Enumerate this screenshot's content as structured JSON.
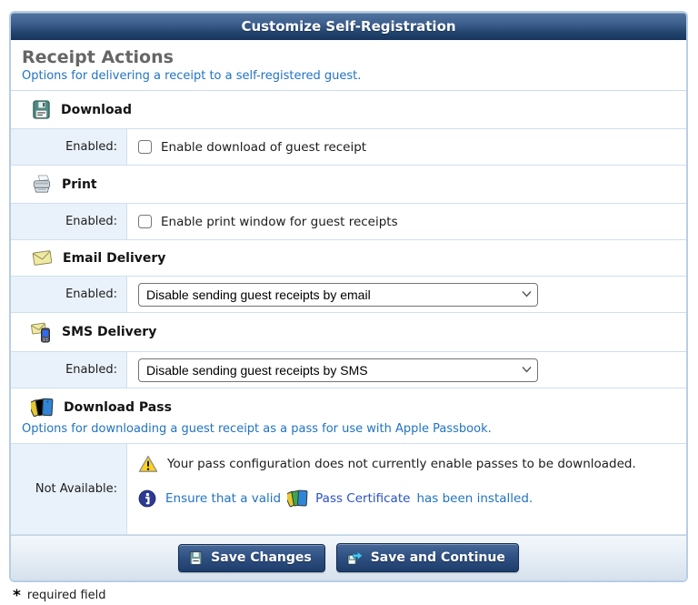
{
  "title": "Customize Self-Registration",
  "section": {
    "title": "Receipt Actions",
    "subtitle": "Options for delivering a receipt to a self-registered guest."
  },
  "items": {
    "download": {
      "title": "Download",
      "label": "Enabled:",
      "checkbox_label": "Enable download of guest receipt",
      "checked": false
    },
    "print": {
      "title": "Print",
      "label": "Enabled:",
      "checkbox_label": "Enable print window for guest receipts",
      "checked": false
    },
    "email": {
      "title": "Email Delivery",
      "label": "Enabled:",
      "selected_option": "Disable sending guest receipts by email"
    },
    "sms": {
      "title": "SMS Delivery",
      "label": "Enabled:",
      "selected_option": "Disable sending guest receipts by SMS"
    },
    "pass": {
      "title": "Download Pass",
      "subtitle": "Options for downloading a guest receipt as a pass for use with Apple Passbook.",
      "label": "Not Available:",
      "warning_text": "Your pass configuration does not currently enable passes to be downloaded.",
      "info_prefix": "Ensure that a valid",
      "info_link": "Pass Certificate",
      "info_suffix": "has been installed."
    }
  },
  "footer": {
    "save_label": "Save Changes",
    "save_continue_label": "Save and Continue"
  },
  "required_note": {
    "asterisk": "*",
    "text": "required field"
  },
  "colors": {
    "titlebar_navy": "#16345e",
    "link_blue": "#2173c4",
    "panel_border": "#b7cee5",
    "label_column_bg": "#e9f2fa",
    "button_navy": "#1e3d6c"
  }
}
